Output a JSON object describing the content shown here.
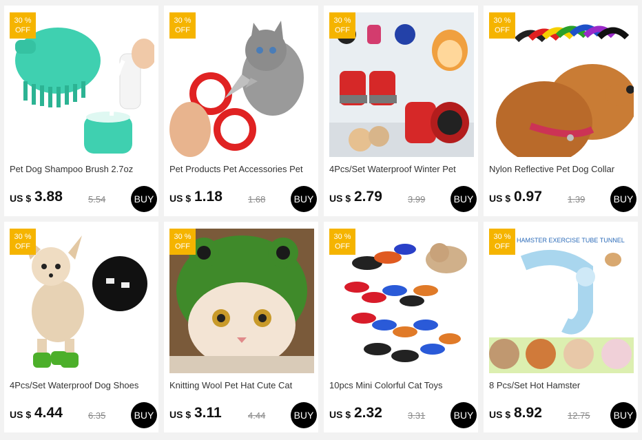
{
  "products": [
    {
      "badge_pct": "30 %",
      "badge_off": "OFF",
      "title": "Pet Dog Shampoo Brush 2.7oz",
      "currency": "US $",
      "price": "3.88",
      "old_price": "5.54",
      "buy_label": "BUY"
    },
    {
      "badge_pct": "30 %",
      "badge_off": "OFF",
      "title": "Pet Products Pet Accessories Pet",
      "currency": "US $",
      "price": "1.18",
      "old_price": "1.68",
      "buy_label": "BUY"
    },
    {
      "badge_pct": "30 %",
      "badge_off": "OFF",
      "title": "4Pcs/Set Waterproof Winter Pet",
      "currency": "US $",
      "price": "2.79",
      "old_price": "3.99",
      "buy_label": "BUY"
    },
    {
      "badge_pct": "30 %",
      "badge_off": "OFF",
      "title": "Nylon Reflective Pet Dog Collar",
      "currency": "US $",
      "price": "0.97",
      "old_price": "1.39",
      "buy_label": "BUY"
    },
    {
      "badge_pct": "30 %",
      "badge_off": "OFF",
      "title": "4Pcs/Set Waterproof Dog Shoes",
      "currency": "US $",
      "price": "4.44",
      "old_price": "6.35",
      "buy_label": "BUY"
    },
    {
      "badge_pct": "30 %",
      "badge_off": "OFF",
      "title": "Knitting Wool Pet Hat Cute Cat",
      "currency": "US $",
      "price": "3.11",
      "old_price": "4.44",
      "buy_label": "BUY"
    },
    {
      "badge_pct": "30 %",
      "badge_off": "OFF",
      "title": "10pcs Mini Colorful Cat Toys",
      "currency": "US $",
      "price": "2.32",
      "old_price": "3.31",
      "buy_label": "BUY"
    },
    {
      "badge_pct": "30 %",
      "badge_off": "OFF",
      "title": "8 Pcs/Set Hot Hamster",
      "currency": "US $",
      "price": "8.92",
      "old_price": "12.75",
      "buy_label": "BUY"
    }
  ],
  "image_texts": {
    "hamster_banner": "HAMSTER EXERCISE TUBE TUNNEL"
  },
  "colors": {
    "badge": "#f5b400",
    "buy": "#000000"
  }
}
